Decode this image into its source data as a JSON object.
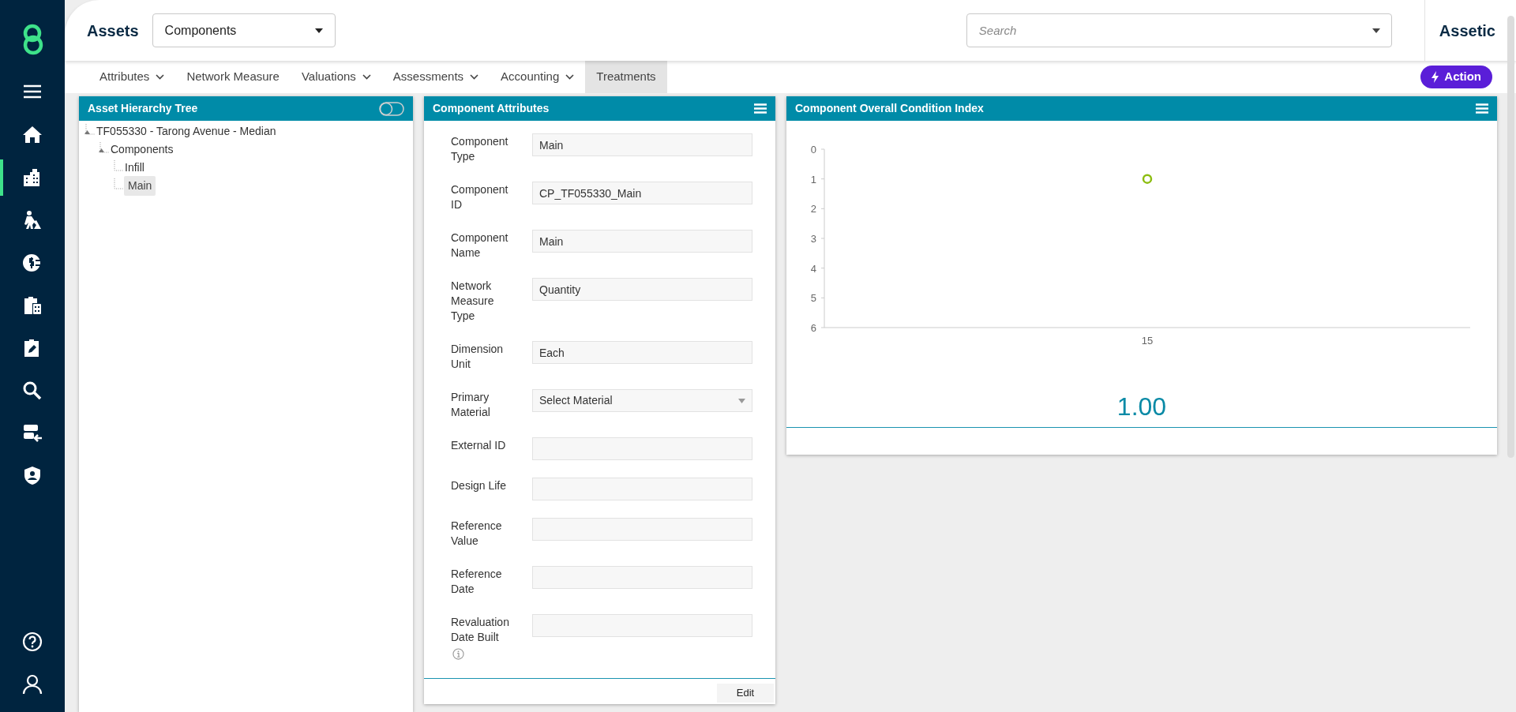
{
  "sidebar": {
    "items": [
      {
        "kind": "menu",
        "selected": false
      },
      {
        "kind": "home",
        "selected": false
      },
      {
        "kind": "buildings",
        "selected": true
      },
      {
        "kind": "worker",
        "selected": false
      },
      {
        "kind": "finance",
        "selected": false
      },
      {
        "kind": "calculator",
        "selected": false
      },
      {
        "kind": "edit",
        "selected": false
      },
      {
        "kind": "search",
        "selected": false
      },
      {
        "kind": "import",
        "selected": false
      },
      {
        "kind": "shield",
        "selected": false
      }
    ],
    "bottom_items": [
      {
        "kind": "help"
      },
      {
        "kind": "user"
      }
    ]
  },
  "header": {
    "title": "Assets",
    "module_select": "Components",
    "search": {
      "placeholder": "Search"
    },
    "brand": "Assetic"
  },
  "nav_tabs": [
    {
      "label": "Attributes",
      "has_menu": true,
      "selected": false
    },
    {
      "label": "Network Measure",
      "has_menu": false,
      "selected": false
    },
    {
      "label": "Valuations",
      "has_menu": true,
      "selected": false
    },
    {
      "label": "Assessments",
      "has_menu": true,
      "selected": false
    },
    {
      "label": "Accounting",
      "has_menu": true,
      "selected": false
    },
    {
      "label": "Treatments",
      "has_menu": false,
      "selected": true
    }
  ],
  "action_button": "Action",
  "tree_panel": {
    "title": "Asset Hierarchy Tree",
    "toggle_on": false,
    "items": [
      {
        "label": "TF055330 - Tarong Avenue - Median",
        "selected": false,
        "expanded": true,
        "children": [
          {
            "label": "Components",
            "selected": false,
            "expanded": true,
            "children": [
              {
                "label": "Infill",
                "selected": false
              },
              {
                "label": "Main",
                "selected": true
              }
            ]
          }
        ]
      }
    ]
  },
  "attributes_panel": {
    "title": "Component Attributes",
    "fields": [
      {
        "label": "Component Type",
        "kind": "text",
        "value": "Main"
      },
      {
        "label": "Component ID",
        "kind": "text",
        "value": "CP_TF055330_Main"
      },
      {
        "label": "Component Name",
        "kind": "text",
        "value": "Main"
      },
      {
        "label": "Network Measure Type",
        "kind": "text",
        "value": "Quantity"
      },
      {
        "label": "Dimension Unit",
        "kind": "text",
        "value": "Each"
      },
      {
        "label": "Primary Material",
        "kind": "select",
        "value": "Select Material"
      },
      {
        "label": "External ID",
        "kind": "text"
      },
      {
        "label": "Design Life",
        "kind": "text"
      },
      {
        "label": "Reference Value",
        "kind": "text"
      },
      {
        "label": "Reference Date",
        "kind": "text"
      },
      {
        "label": "Revaluation Date Built",
        "kind": "text",
        "info": true
      }
    ],
    "edit_button": "Edit"
  },
  "condition_panel": {
    "title": "Component Overall Condition Index",
    "value": "1.00",
    "chart_data": {
      "type": "scatter",
      "categories": [
        "15"
      ],
      "series": [
        {
          "color": "#8cbd10",
          "values": [
            1
          ]
        }
      ],
      "ylim": [
        6,
        0
      ],
      "yticks": [
        0,
        1,
        2,
        3,
        4,
        5,
        6
      ]
    }
  }
}
